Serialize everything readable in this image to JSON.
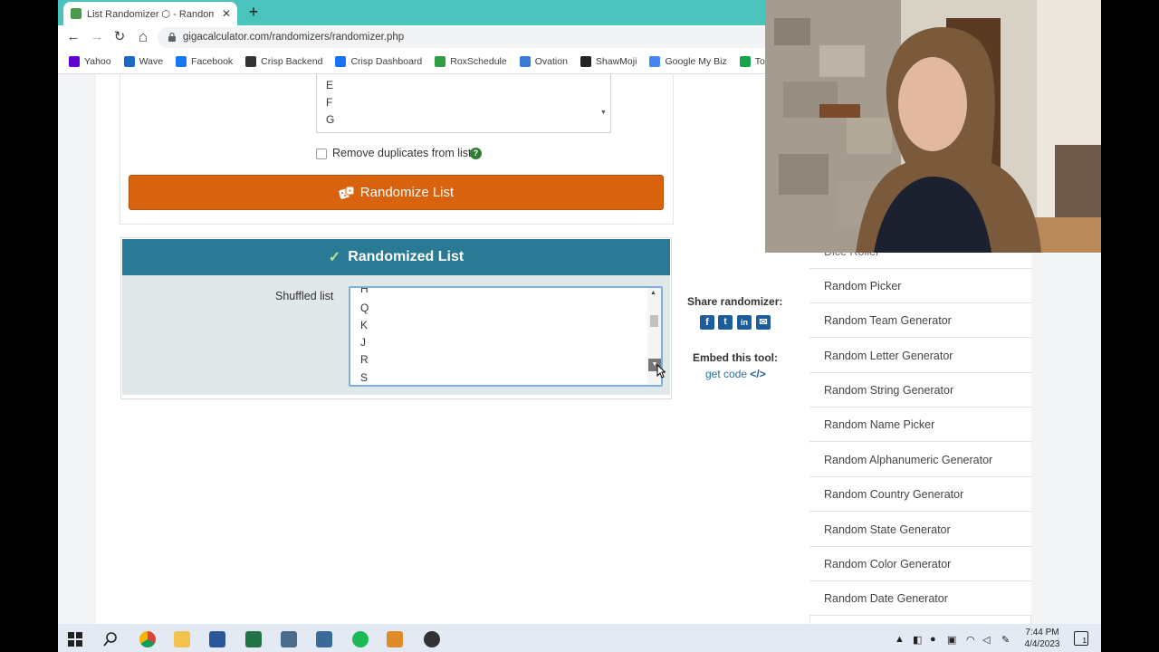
{
  "browser": {
    "tab_title": "List Randomizer ⬡ - Randomize",
    "tab_close": "✕",
    "new_tab": "+",
    "nav": {
      "back": "←",
      "forward": "→",
      "reload": "↻",
      "home": "⌂"
    },
    "url": "gigacalculator.com/randomizers/randomizer.php",
    "bookmarks": [
      {
        "label": "Yahoo",
        "color": "#6001d2"
      },
      {
        "label": "Wave",
        "color": "#1b6ac9"
      },
      {
        "label": "Facebook",
        "color": "#1877f2"
      },
      {
        "label": "Crisp Backend",
        "color": "#333333"
      },
      {
        "label": "Crisp Dashboard",
        "color": "#1972f5"
      },
      {
        "label": "RoxSchedule",
        "color": "#2e9e44"
      },
      {
        "label": "Ovation",
        "color": "#3a7bd5"
      },
      {
        "label": "ShawMoji",
        "color": "#222222"
      },
      {
        "label": "Google My Biz",
        "color": "#4285f4"
      },
      {
        "label": "ToCo payst",
        "color": "#17a34a"
      }
    ]
  },
  "input": {
    "lines": [
      "E",
      "F",
      "G"
    ],
    "remove_duplicates_label": "Remove duplicates from list",
    "remove_duplicates_checked": false,
    "help_icon": "?",
    "randomize_button": "Randomize List"
  },
  "result": {
    "check": "✓",
    "header": "Randomized List",
    "shuffled_label": "Shuffled list",
    "partial_top_line": "H",
    "lines": [
      "Q",
      "K",
      "J",
      "R",
      "S"
    ]
  },
  "share": {
    "label": "Share randomizer:",
    "icons": [
      "f",
      "t",
      "in",
      "✉"
    ],
    "embed_label": "Embed this tool:",
    "get_code": "get code",
    "code_glyph": "</>"
  },
  "sidebar": {
    "partial_item": "Dice Roller",
    "items": [
      "Random Picker",
      "Random Team Generator",
      "Random Letter Generator",
      "Random String Generator",
      "Random Name Picker",
      "Random Alphanumeric Generator",
      "Random Country Generator",
      "Random State Generator",
      "Random Color Generator",
      "Random Date Generator"
    ]
  },
  "taskbar": {
    "time": "7:44 PM",
    "date": "4/4/2023",
    "notification_count": "1"
  }
}
